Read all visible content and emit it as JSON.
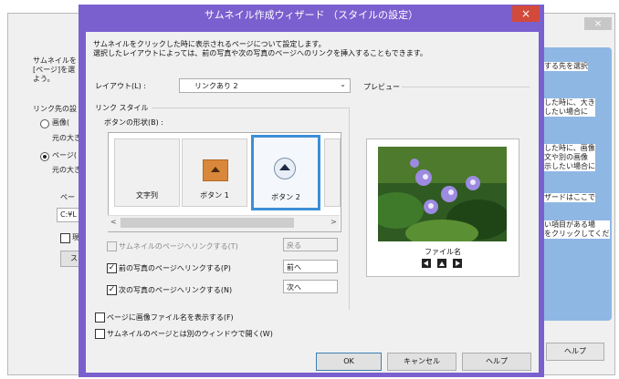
{
  "background_window": {
    "close_glyph": "×",
    "left_text_1": "サムネイルを\n[ページ]を選\nよう。",
    "left_text_2": "リンク先の設",
    "radio_1": "画像(",
    "radio_1_sub": "元の大き",
    "radio_2": "ページ(",
    "radio_2_sub": "元の大き",
    "page_label": "ペー",
    "path_value": "C:¥L",
    "checkbox_label": "現",
    "button_label": "ス",
    "right_texts": [
      "する先を選択",
      "した時に、大き\nしたい場合に",
      "した時に、画像\n文や別の画像\n示したい場合に",
      "ザードはここで",
      "い項目がある場\nをクリックしてくだ"
    ],
    "help_button": "ヘルプ"
  },
  "dialog": {
    "title": "サムネイル作成ウィザード （スタイルの設定）",
    "close_glyph": "×",
    "description": "サムネイルをクリックした時に表示されるページについて設定します。\n選択したレイアウトによっては、前の写真や次の写真のページへのリンクを挿入することもできます。",
    "layout_label": "レイアウト(L) :",
    "layout_value": "リンクあり 2",
    "link_style_label": "リンク スタイル",
    "button_shape_label": "ボタンの形状(B) :",
    "shapes": [
      {
        "caption": "文字列"
      },
      {
        "caption": "ボタン 1"
      },
      {
        "caption": "ボタン 2",
        "selected": true
      }
    ],
    "link_to_thumb_label": "サムネイルのページへリンクする(T)",
    "link_to_thumb_checked": false,
    "link_to_thumb_value": "戻る",
    "link_prev_label": "前の写真のページへリンクする(P)",
    "link_prev_checked": true,
    "link_prev_value": "前へ",
    "link_next_label": "次の写真のページへリンクする(N)",
    "link_next_checked": true,
    "link_next_value": "次へ",
    "show_filename_label": "ページに画像ファイル名を表示する(F)",
    "show_filename_checked": false,
    "open_new_window_label": "サムネイルのページとは別のウィンドウで開く(W)",
    "open_new_window_checked": false,
    "preview_label": "プレビュー",
    "preview_caption": "ファイル名",
    "ok_label": "OK",
    "cancel_label": "キャンセル",
    "help_label": "ヘルプ"
  },
  "colors": {
    "dialog_frame": "#7a5fcf",
    "close_button": "#d24a3b",
    "selection_border": "#3c8fd6",
    "button_orange": "#d9873a"
  }
}
